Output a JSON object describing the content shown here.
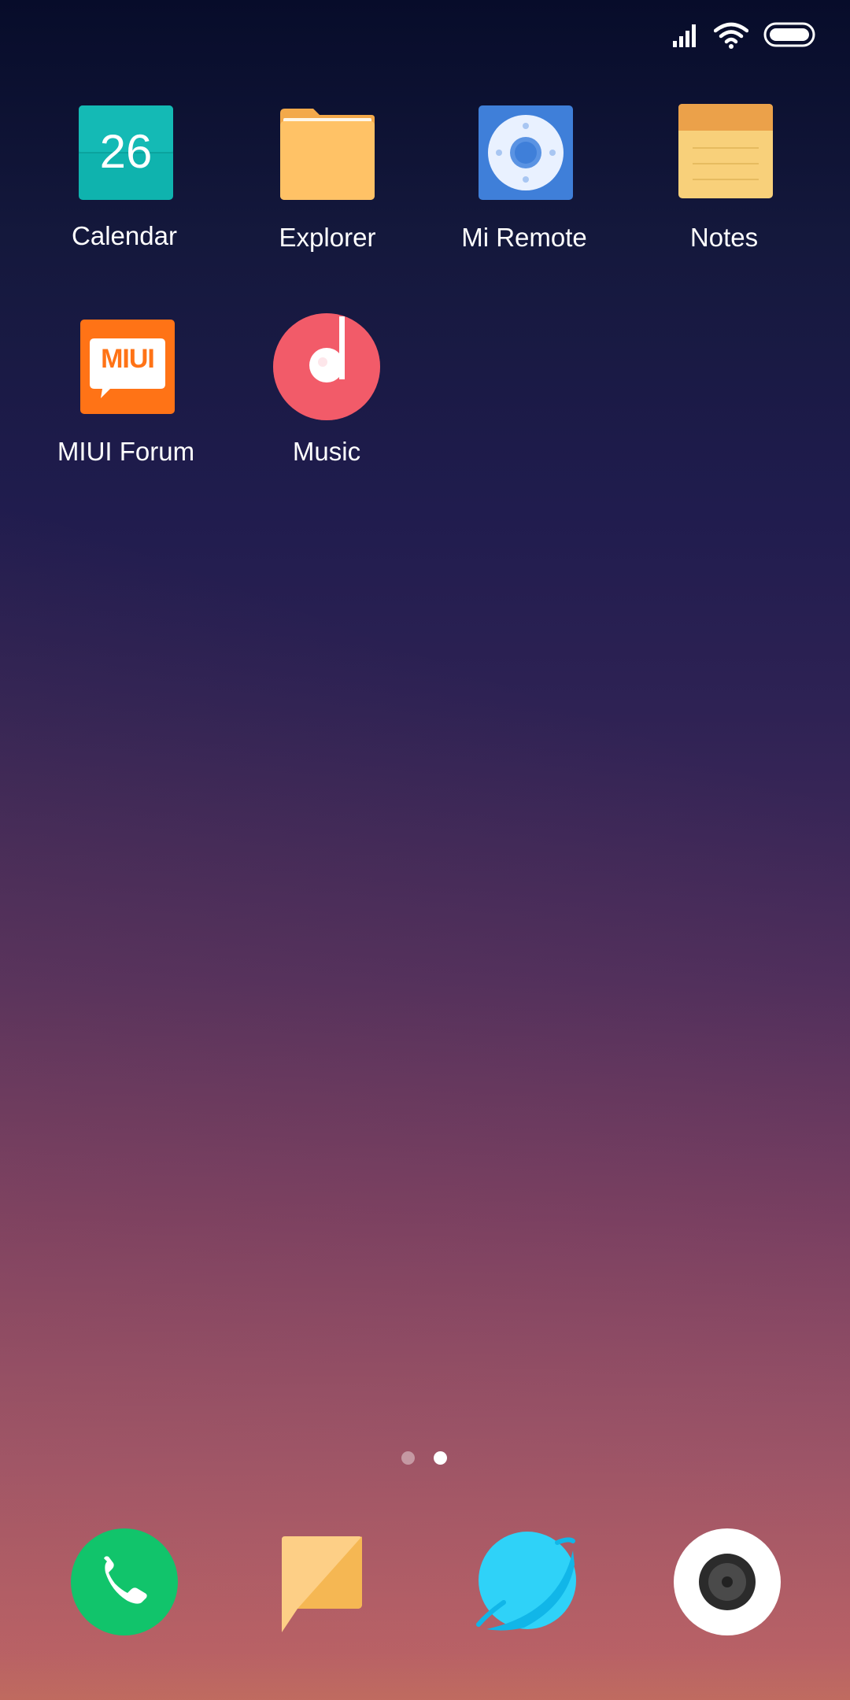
{
  "status_bar": {
    "icons": [
      "cellular-signal-icon",
      "wifi-icon",
      "battery-icon"
    ]
  },
  "home_screen": {
    "apps": [
      {
        "label": "Calendar",
        "icon": "calendar-icon",
        "date": "26",
        "color": "#0fb3ae"
      },
      {
        "label": "Explorer",
        "icon": "folder-icon",
        "color": "#ffc266"
      },
      {
        "label": "Mi Remote",
        "icon": "remote-icon",
        "color": "#3f7fd9"
      },
      {
        "label": "Notes",
        "icon": "notes-icon",
        "color": "#f8d07a"
      },
      {
        "label": "MIUI Forum",
        "icon": "miui-forum-icon",
        "badge_text": "MIUI",
        "color": "#ff7316"
      },
      {
        "label": "Music",
        "icon": "music-icon",
        "color": "#f4606d"
      }
    ]
  },
  "page_indicator": {
    "pages": 2,
    "active_page": 2
  },
  "dock": {
    "apps": [
      {
        "icon": "phone-icon",
        "color": "#11c46b"
      },
      {
        "icon": "messaging-icon",
        "color": "#fdcf86"
      },
      {
        "icon": "browser-icon",
        "color": "#2fd2f8"
      },
      {
        "icon": "camera-icon",
        "color": "#ffffff"
      }
    ]
  }
}
